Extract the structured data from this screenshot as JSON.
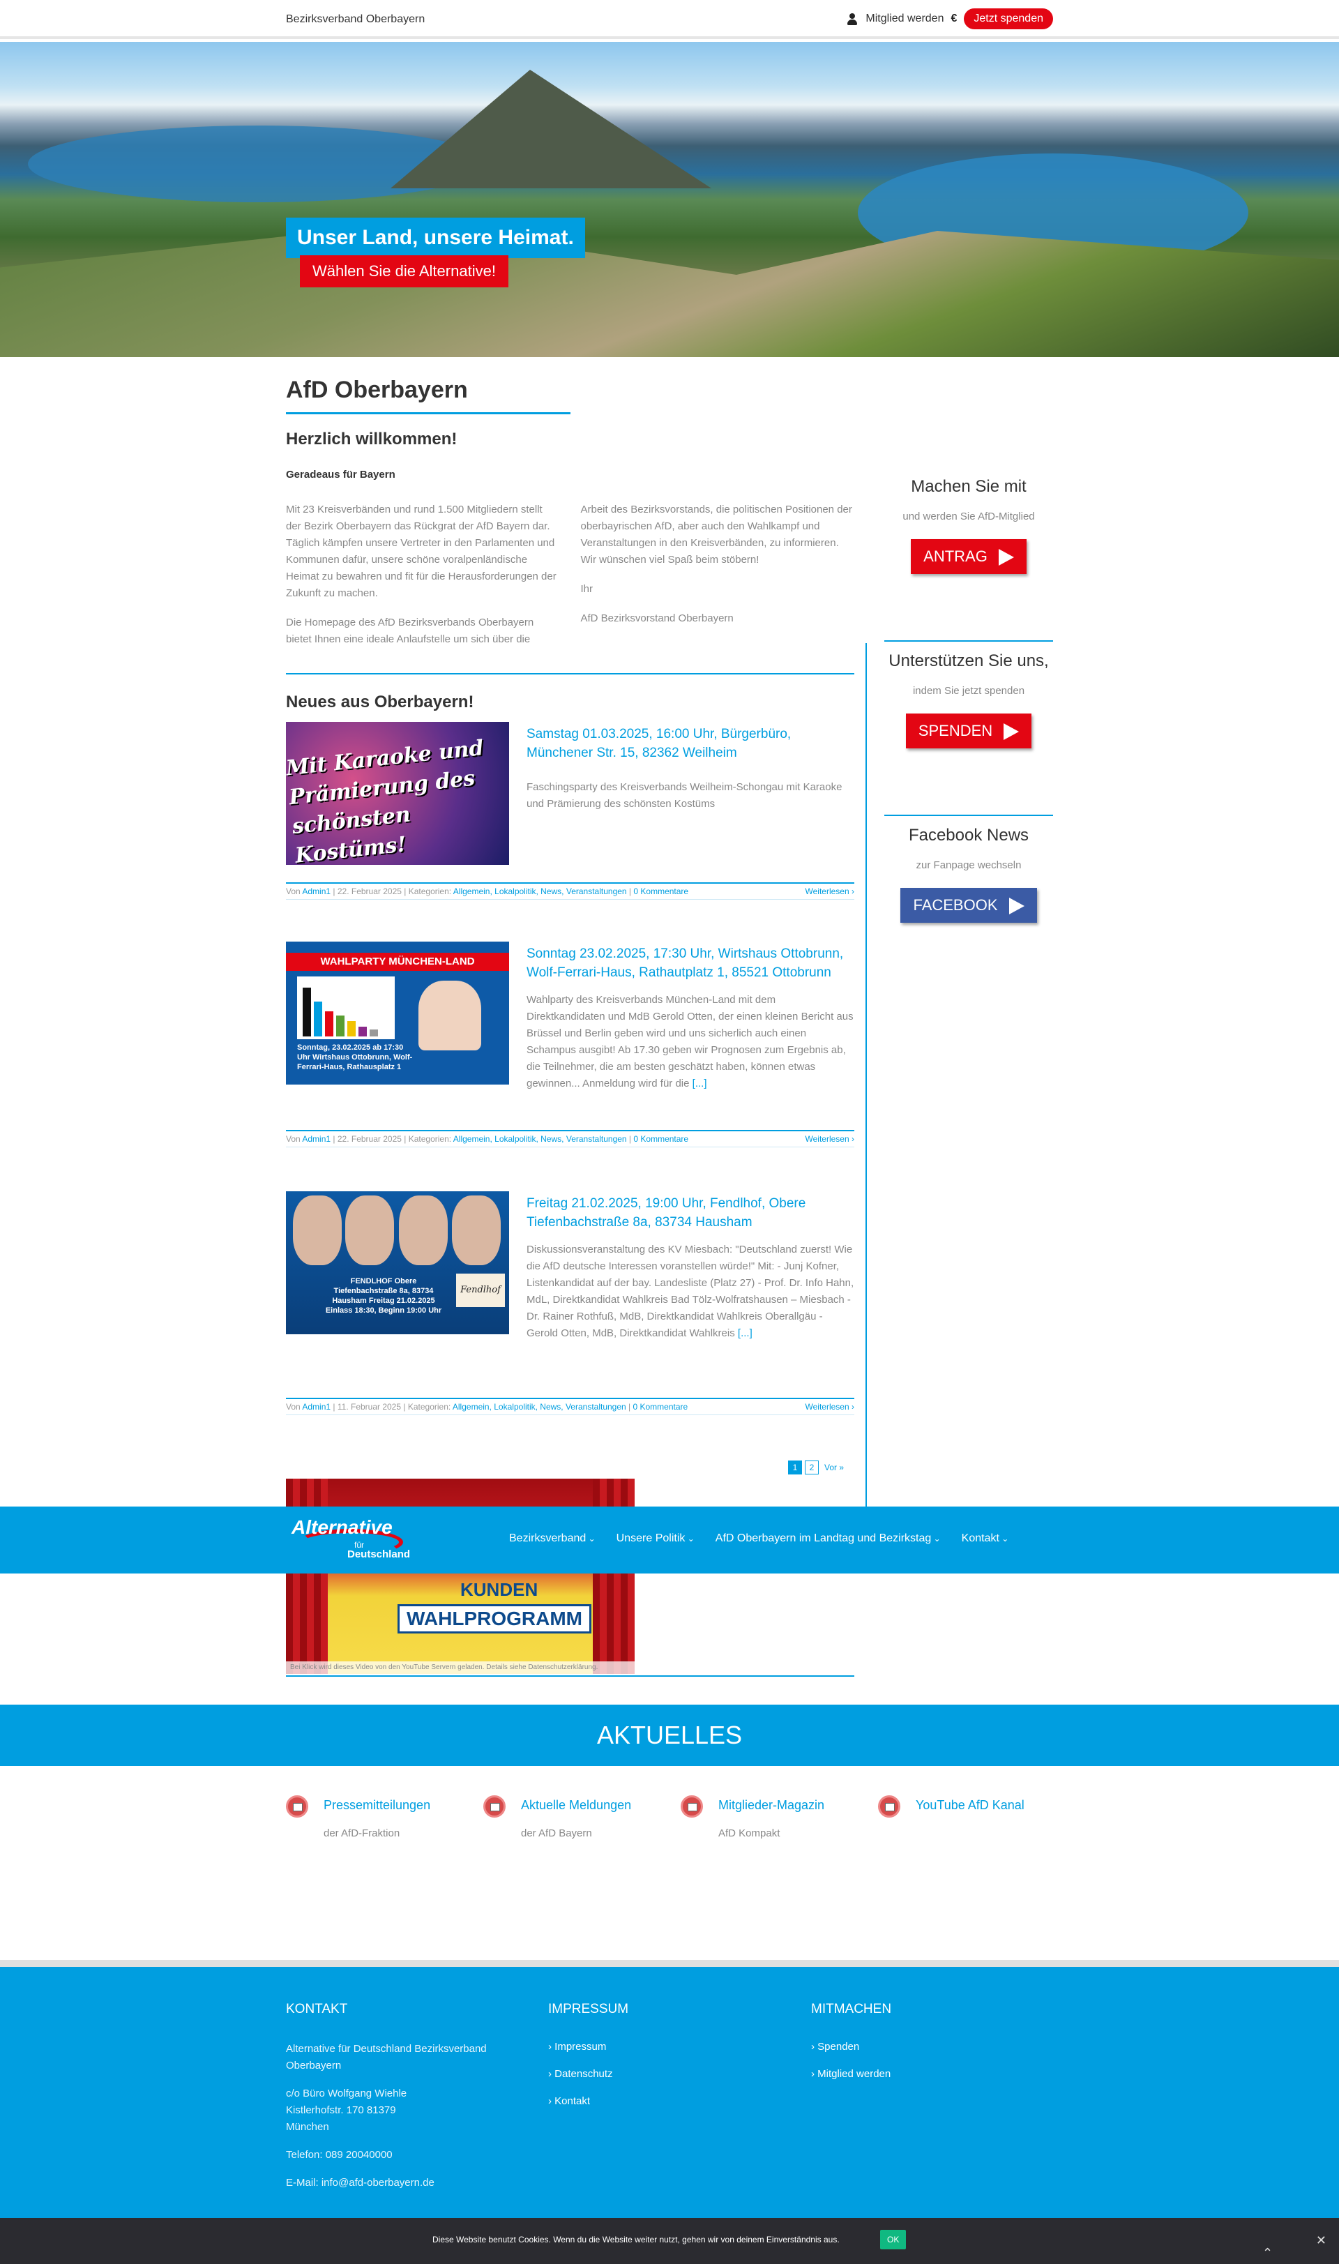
{
  "topbar": {
    "site_name": "Bezirksverband Oberbayern",
    "member_label": "Mitglied werden",
    "euro_symbol": "€",
    "donate_label": "Jetzt spenden"
  },
  "hero": {
    "slogan_1": "Unser Land, unsere Heimat.",
    "slogan_2": "Wählen Sie die Alternative!"
  },
  "main": {
    "title": "AfD Oberbayern",
    "welcome": "Herzlich willkommen!",
    "subtitle": "Geradeaus für Bayern",
    "col1_p1": "Mit 23 Kreisverbänden und rund 1.500 Mitgliedern stellt der Bezirk Oberbayern das Rückgrat der AfD Bayern dar. Täglich kämpfen unsere Vertreter in den Parlamenten und Kommunen dafür, unsere schöne voralpenländische Heimat zu bewahren und fit für die Herausforderungen der Zukunft zu machen.",
    "col1_p2": "Die Homepage des AfD Bezirksverbands Oberbayern bietet Ihnen eine ideale Anlaufstelle um sich über die",
    "col2_p1": "Arbeit des Bezirksvorstands, die politischen Positionen der oberbayrischen AfD, aber auch den Wahlkampf und Veranstaltungen in den Kreisverbänden, zu informieren. Wir wünschen viel Spaß beim stöbern!",
    "col2_p2": "Ihr",
    "col2_p3": "AfD Bezirksvorstand Oberbayern",
    "news_title": "Neues aus Oberbayern!"
  },
  "posts": [
    {
      "title": "Samstag 01.03.2025, 16:00 Uhr, Bürgerbüro, Münchener Str. 15, 82362 Weilheim",
      "excerpt": "Faschingsparty des Kreisverbands Weilheim-Schongau mit Karaoke und Prämierung des schönsten Kostüms",
      "more": "",
      "thumb_text": "Mit Karaoke und Prämierung des schönsten Kostüms!",
      "meta_by": "Von",
      "author": "Admin1",
      "date": "22. Februar 2025",
      "cat_label": "Kategorien:",
      "categories": "Allgemein, Lokalpolitik, News, Veranstaltungen",
      "comments": "0 Kommentare",
      "read_more": "Weiterlesen ›"
    },
    {
      "title": "Sonntag 23.02.2025, 17:30 Uhr, Wirtshaus Ottobrunn, Wolf-Ferrari-Haus, Rathautplatz 1, 85521 Ottobrunn",
      "excerpt": "Wahlparty des Kreisverbands München-Land mit dem Direktkandidaten und MdB Gerold Otten, der einen kleinen Bericht aus Brüssel und Berlin geben wird und uns sicherlich auch einen Schampus ausgibt! Ab 17.30 geben wir Prognosen zum Ergebnis ab, die Teilnehmer, die am besten geschätzt haben, können etwas gewinnen... Anmeldung wird für die",
      "more": "[...]",
      "thumb_banner": "WAHLPARTY MÜNCHEN-LAND",
      "thumb_info": "Sonntag, 23.02.2025 ab 17:30 Uhr Wirtshaus Ottobrunn, Wolf-Ferrari-Haus, Rathausplatz 1",
      "meta_by": "Von",
      "author": "Admin1",
      "date": "22. Februar 2025",
      "cat_label": "Kategorien:",
      "categories": "Allgemein, Lokalpolitik, News, Veranstaltungen",
      "comments": "0 Kommentare",
      "read_more": "Weiterlesen ›"
    },
    {
      "title": "Freitag 21.02.2025, 19:00 Uhr, Fendlhof, Obere Tiefenbachstraße 8a, 83734 Hausham",
      "excerpt": "Diskussionsveranstaltung des KV Miesbach: \"Deutschland zuerst! Wie die AfD deutsche Interessen voranstellen würde!\" Mit: - Junj Kofner, Listenkandidat auf der bay. Landesliste (Platz 27) - Prof. Dr. Info Hahn, MdL, Direktkandidat Wahlkreis Bad Tölz-Wolfratshausen – Miesbach - Dr. Rainer Rothfuß, MdB, Direktkandidat Wahlkreis Oberallgäu - Gerold Otten, MdB, Direktkandidat Wahlkreis",
      "more": "[...]",
      "thumb_box": "FENDLHOF Obere Tiefenbachstraße 8a, 83734 Hausham Freitag 21.02.2025 Einlass 18:30, Beginn 19:00 Uhr",
      "thumb_logo": "Fendlhof",
      "meta_by": "Von",
      "author": "Admin1",
      "date": "11. Februar 2025",
      "cat_label": "Kategorien:",
      "categories": "Allgemein, Lokalpolitik, News, Veranstaltungen",
      "comments": "0 Kommentare",
      "read_more": "Weiterlesen ›"
    }
  ],
  "pagination": {
    "page1": "1",
    "page2": "2",
    "next": "Vor »"
  },
  "video": {
    "label": "KUNDEN",
    "title": "WAHLPROGRAMM",
    "notice": "Bei Klick wird dieses Video von den YouTube Servern geladen. Details siehe Datenschutzerklärung."
  },
  "nav": {
    "logo_1": "Alternative",
    "logo_2": "für",
    "logo_3": "Deutschland",
    "items": [
      "Bezirksverband",
      "Unsere Politik",
      "AfD Oberbayern im Landtag und Bezirkstag",
      "Kontakt"
    ]
  },
  "sidebar": [
    {
      "title": "Machen Sie mit",
      "sub": "und werden Sie AfD-Mitglied",
      "button": "ANTRAG"
    },
    {
      "title": "Unterstützen Sie uns,",
      "sub": "indem Sie jetzt spenden",
      "button": "SPENDEN"
    },
    {
      "title": "Facebook News",
      "sub": "zur Fanpage wechseln",
      "button": "FACEBOOK"
    }
  ],
  "aktuelles": {
    "title": "AKTUELLES",
    "items": [
      {
        "title": "Pressemitteilungen",
        "sub": "der AfD-Fraktion"
      },
      {
        "title": "Aktuelle Meldungen",
        "sub": "der AfD Bayern"
      },
      {
        "title": "Mitglieder-Magazin",
        "sub": "AfD Kompakt"
      },
      {
        "title": "YouTube AfD Kanal",
        "sub": ""
      }
    ]
  },
  "footer": {
    "kontakt": {
      "title": "KONTAKT",
      "org": "Alternative für Deutschland Bezirksverband Oberbayern",
      "address": "c/o Büro Wolfgang Wiehle Kistlerhofstr. 170 81379 München",
      "phone": "Telefon: 089 20040000",
      "email": "E-Mail: info@afd-oberbayern.de"
    },
    "impressum": {
      "title": "IMPRESSUM",
      "links": [
        "Impressum",
        "Datenschutz",
        "Kontakt"
      ]
    },
    "mitmachen": {
      "title": "MITMACHEN",
      "links": [
        "Spenden",
        "Mitglied werden"
      ]
    }
  },
  "cookie": {
    "text": "Diese Website benutzt Cookies. Wenn du die Website weiter nutzt, gehen wir von deinem Einverständnis aus.",
    "ok": "OK",
    "close": "✕",
    "scroll_up": "⌃"
  },
  "colors": {
    "brand_blue": "#009ee0",
    "brand_red": "#e30613",
    "facebook": "#3b5ba5"
  }
}
